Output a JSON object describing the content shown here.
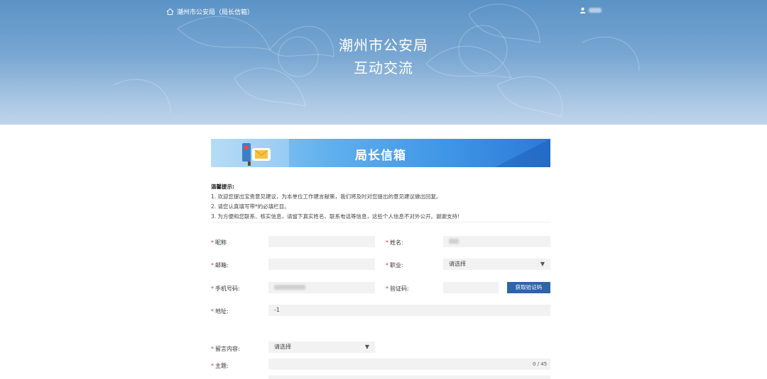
{
  "header": {
    "home_link": "潮州市公安局（局长信箱）",
    "title_line1": "潮州市公安局",
    "title_line2": "互动交流"
  },
  "banner": {
    "title": "局长信箱"
  },
  "notes": {
    "heading": "温馨提示:",
    "items": [
      "1. 欢迎您提出宝贵意见建议，为本单位工作建言献策，我们将及时对您提出的意见建议做出回复。",
      "2. 请您认真填写带*的必填栏目。",
      "3. 为方便和您联系、核实信息，请留下真实姓名、联系电话等信息，这些个人信息不对外公开。谢谢支持!"
    ]
  },
  "form": {
    "nickname_label": "昵称",
    "name_label": "姓名:",
    "email_label": "邮箱:",
    "job_label": "职业:",
    "job_value": "请选择",
    "phone_label": "手机号码:",
    "code_label": "验证码:",
    "code_button": "获取验证码",
    "address_label": "地址:",
    "address_value": "-1",
    "content_label": "留言内容:",
    "content_value": "请选择",
    "subject_label": "主题:",
    "subject_counter": "0 / 45"
  }
}
